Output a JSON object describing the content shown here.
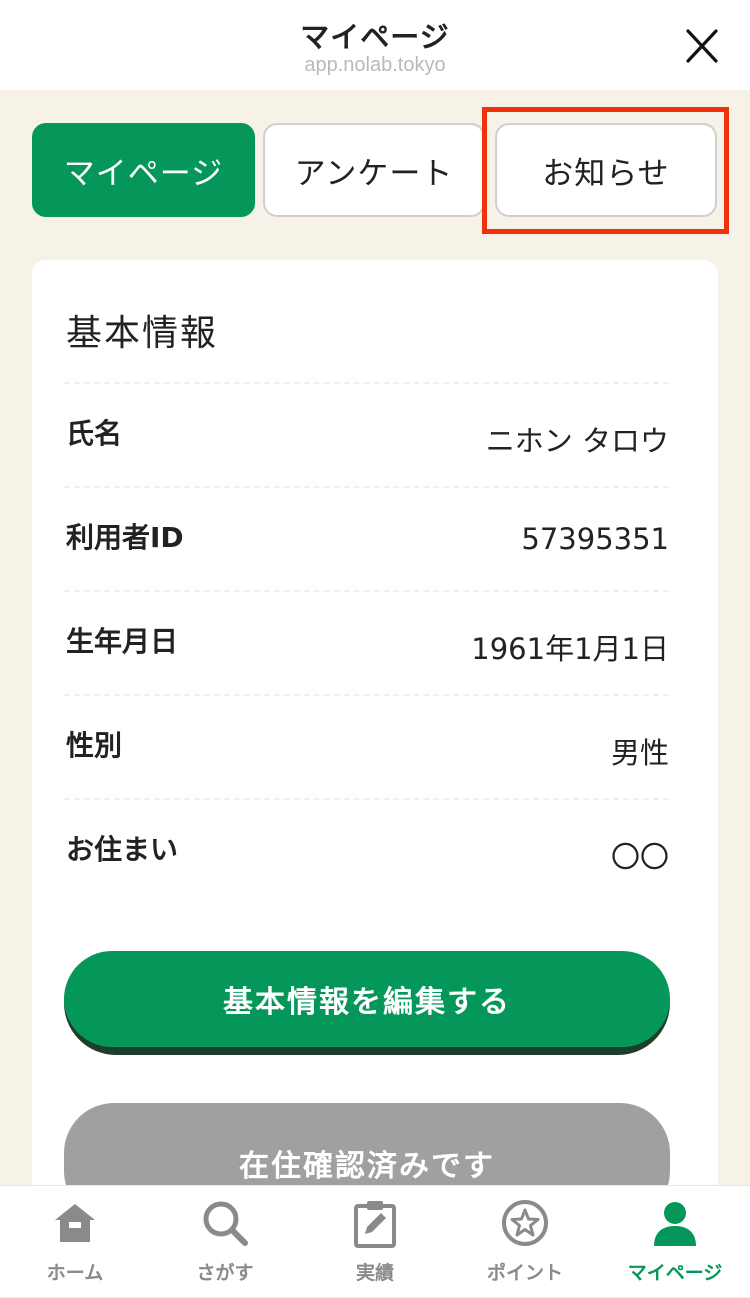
{
  "header": {
    "title": "マイページ",
    "url": "app.nolab.tokyo",
    "close_icon": "close-icon"
  },
  "tabs": [
    {
      "label": "マイページ",
      "active": true
    },
    {
      "label": "アンケート",
      "active": false
    },
    {
      "label": "お知らせ",
      "active": false,
      "highlighted": true
    }
  ],
  "basic_info": {
    "title": "基本情報",
    "rows": [
      {
        "label": "氏名",
        "value": "ニホン タロウ"
      },
      {
        "label": "利用者ID",
        "value": "57395351"
      },
      {
        "label": "生年月日",
        "value": "1961年1月1日"
      },
      {
        "label": "性別",
        "value": "男性"
      },
      {
        "label": "お住まい",
        "value": "〇〇"
      }
    ],
    "edit_button": "基本情報を編集する",
    "residence_button": "在住確認済みです"
  },
  "bottom_nav": [
    {
      "label": "ホーム",
      "icon": "home-icon",
      "active": false
    },
    {
      "label": "さがす",
      "icon": "search-icon",
      "active": false
    },
    {
      "label": "実績",
      "icon": "clipboard-edit-icon",
      "active": false
    },
    {
      "label": "ポイント",
      "icon": "star-circle-icon",
      "active": false
    },
    {
      "label": "マイページ",
      "icon": "user-icon",
      "active": true
    }
  ],
  "colors": {
    "primary": "#05965a",
    "primary_shadow": "#1e3d2c",
    "background": "#f6f2e7",
    "highlight": "#f0310d",
    "disabled": "#a0a0a0",
    "nav_inactive": "#8a8a8a"
  }
}
